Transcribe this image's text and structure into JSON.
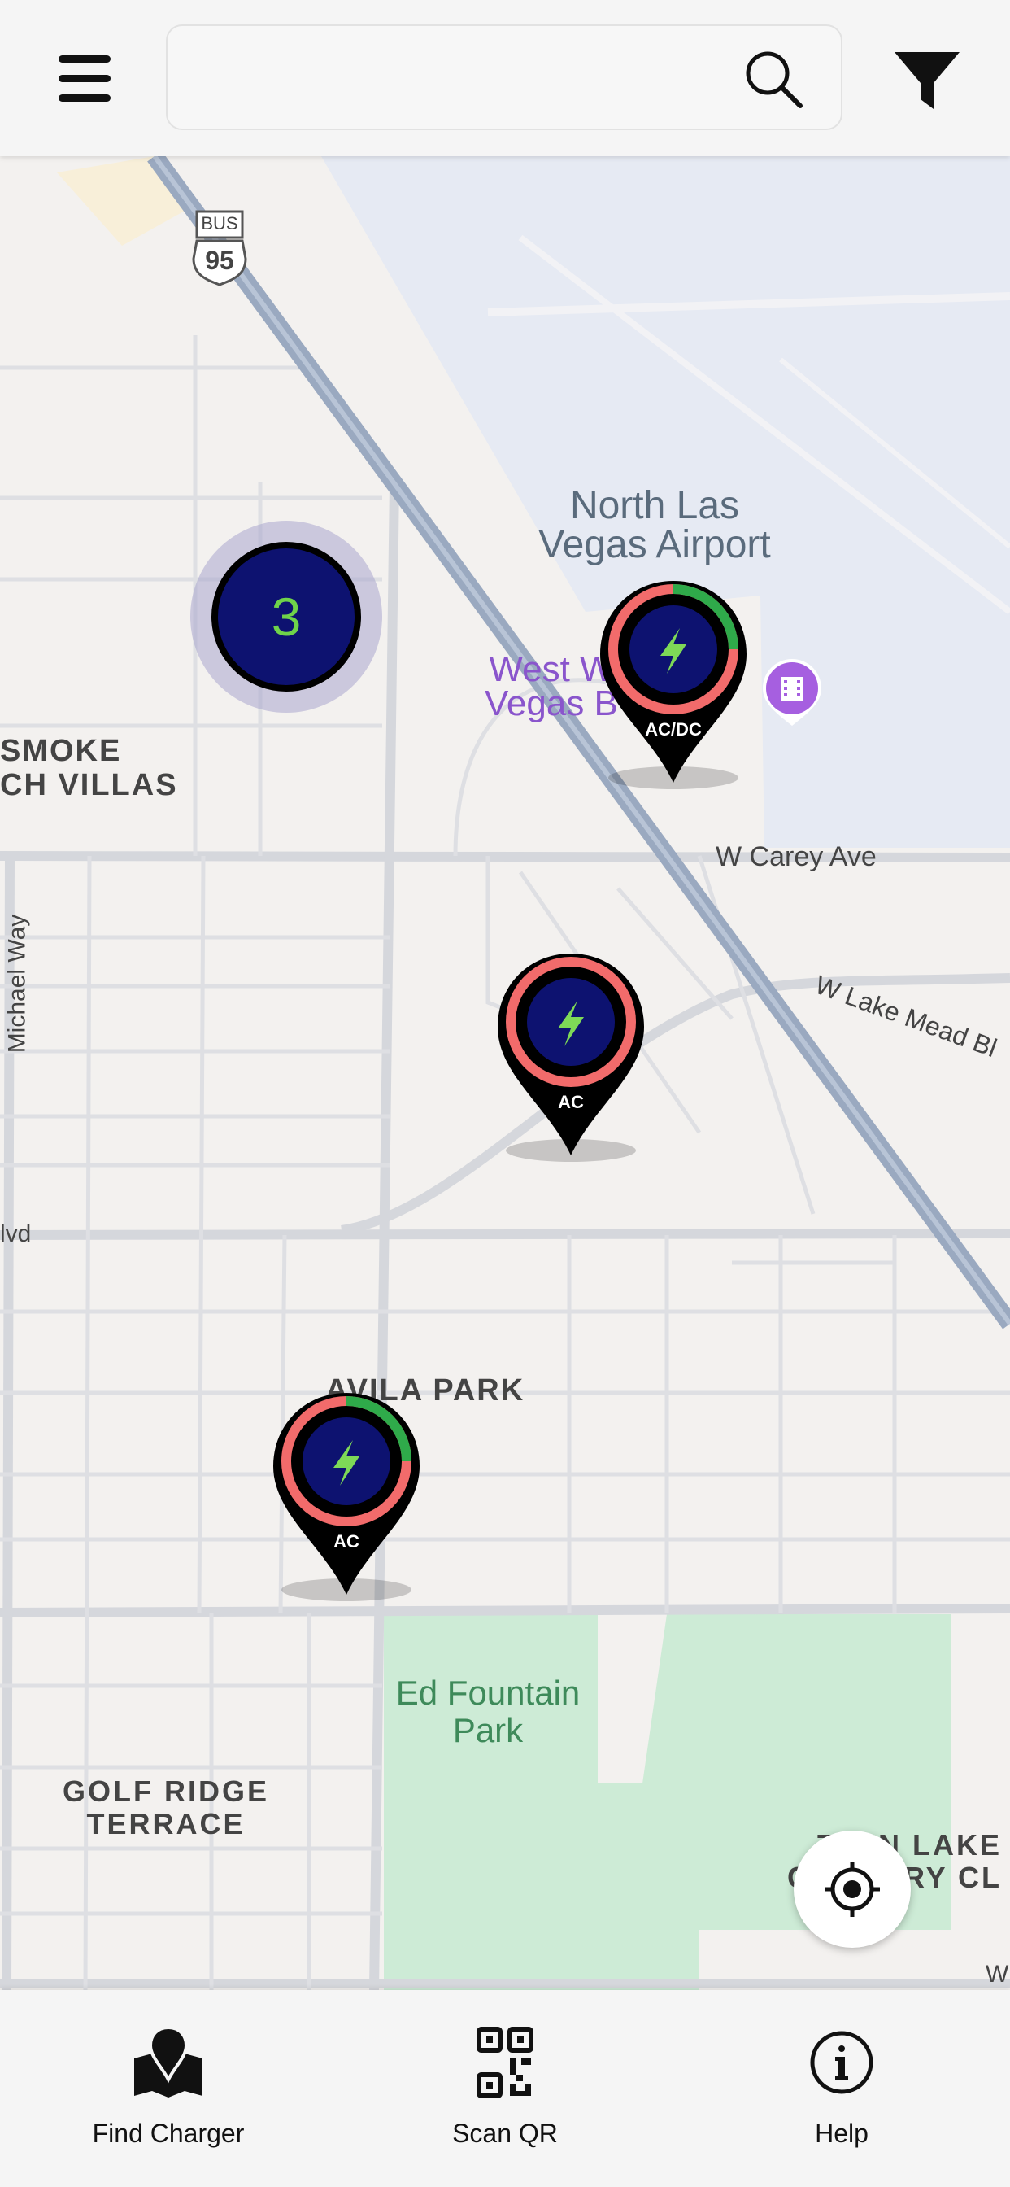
{
  "header": {
    "search": {
      "value": "",
      "placeholder": ""
    }
  },
  "map": {
    "labels": {
      "airport": "North Las\nVegas Airport",
      "west_vegas": "West W\nVegas B",
      "smoke_villas": "SMOKE\nCH VILLAS",
      "carey": "W Carey Ave",
      "lake_mead": "W Lake Mead Bl",
      "michael_way": "Michael Way",
      "blvd": "lvd",
      "avila_park": "AVILA PARK",
      "ed_fountain": "Ed Fountain\nPark",
      "golf_ridge": "GOLF RIDGE\nTERRACE",
      "twin_lake": "TWIN LAKE\nCOUNTRY CL",
      "w_bottom": "W",
      "route_shield_top": "BUS",
      "route_shield_number": "95"
    },
    "cluster": {
      "count": "3"
    },
    "chargers": [
      {
        "type": "AC/DC",
        "available_fraction": 0.25
      },
      {
        "type": "AC",
        "available_fraction": 0
      },
      {
        "type": "AC",
        "available_fraction": 0.25
      }
    ],
    "colors": {
      "available": "#2faa4a",
      "occupied": "#f26b6b",
      "pin_fill": "#0d1270",
      "bolt": "#7ed957"
    }
  },
  "bottom_nav": {
    "items": [
      {
        "label": "Find Charger",
        "icon": "map-icon"
      },
      {
        "label": "Scan QR",
        "icon": "qr-code-icon"
      },
      {
        "label": "Help",
        "icon": "info-icon"
      }
    ]
  }
}
